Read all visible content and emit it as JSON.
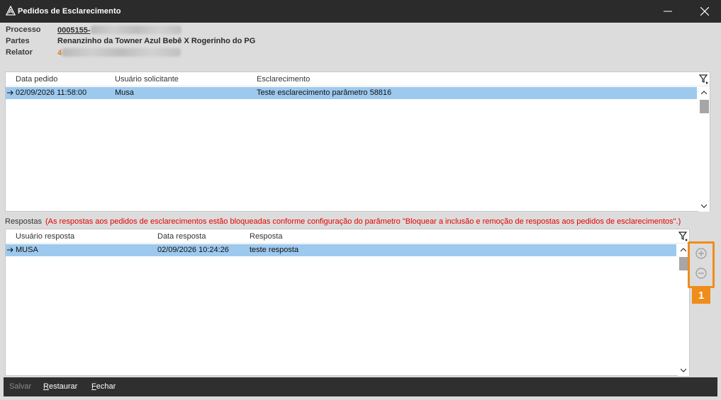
{
  "window": {
    "title": "Pedidos de Esclarecimento",
    "app_icon": "app-logo-icon",
    "minimize_icon": "minimize-icon",
    "close_icon": "close-icon"
  },
  "info": {
    "processo_label": "Processo",
    "processo_value": "0005155-",
    "partes_label": "Partes",
    "partes_value": "Renanzinho da Towner Azul Bebê X Rogerinho do PG",
    "relator_label": "Relator",
    "relator_value": "4"
  },
  "pedidos_grid": {
    "columns": [
      "Data pedido",
      "Usuário solicitante",
      "Esclarecimento"
    ],
    "rows": [
      {
        "data": "02/09/2026 11:58:00",
        "usuario": "Musa",
        "esclarecimento": "Teste esclarecimento parâmetro 58816"
      }
    ],
    "filter_icon": "filter-icon"
  },
  "respostas": {
    "label": "Respostas",
    "warning": "(As respostas aos pedidos de esclarecimentos estão bloqueadas conforme configuração do parâmetro \"Bloquear a inclusão e remoção de respostas aos pedidos de esclarecimentos\".)",
    "columns": [
      "Usuário resposta",
      "Data resposta",
      "Resposta"
    ],
    "rows": [
      {
        "usuario": "MUSA",
        "data": "02/09/2026 10:24:26",
        "resposta": "teste resposta"
      }
    ],
    "add_icon": "add-circle-icon",
    "remove_icon": "remove-circle-icon",
    "badge": "1"
  },
  "footer": {
    "salvar": "Salvar",
    "restaurar_first": "R",
    "restaurar_rest": "estaurar",
    "fechar_first": "F",
    "fechar_rest": "echar"
  },
  "colors": {
    "titlebar": "#2b2b2b",
    "selected_row": "#9ec9ee",
    "warning_text": "#e60000",
    "highlight": "#f08c1a"
  }
}
